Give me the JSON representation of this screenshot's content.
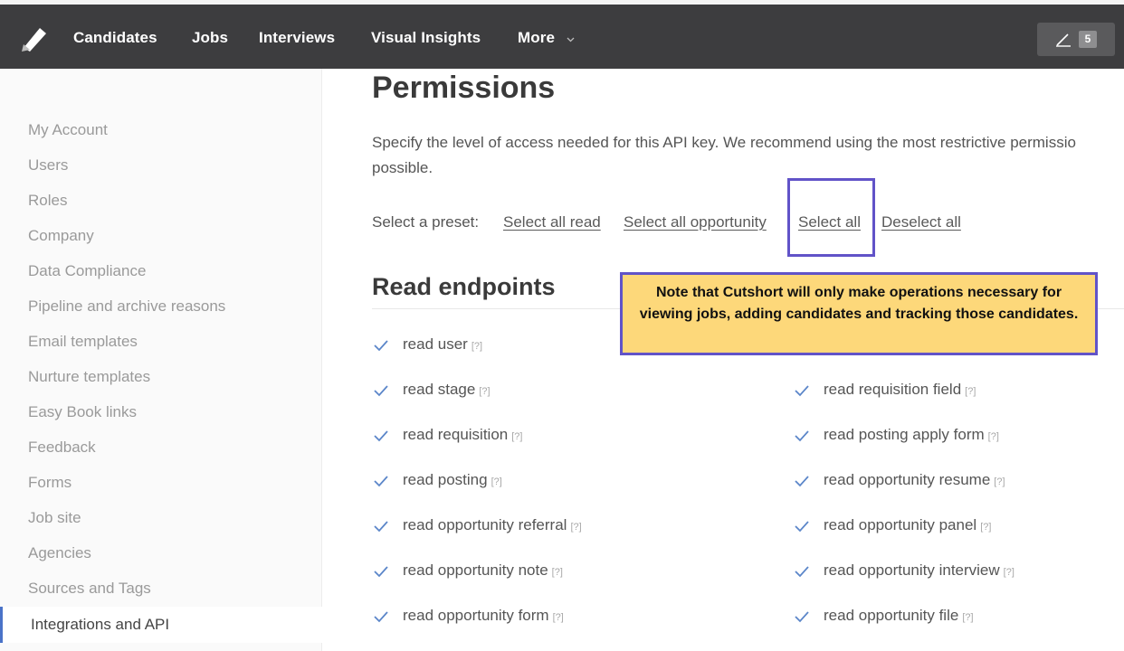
{
  "nav": {
    "items": [
      {
        "label": "Candidates"
      },
      {
        "label": "Jobs"
      },
      {
        "label": "Interviews"
      },
      {
        "label": "Visual Insights"
      },
      {
        "label": "More"
      }
    ],
    "badge_count": "5"
  },
  "sidebar": {
    "items": [
      {
        "label": "My Account"
      },
      {
        "label": "Users"
      },
      {
        "label": "Roles"
      },
      {
        "label": "Company"
      },
      {
        "label": "Data Compliance"
      },
      {
        "label": "Pipeline and archive reasons"
      },
      {
        "label": "Email templates"
      },
      {
        "label": "Nurture templates"
      },
      {
        "label": "Easy Book links"
      },
      {
        "label": "Feedback"
      },
      {
        "label": "Forms"
      },
      {
        "label": "Job site"
      },
      {
        "label": "Agencies"
      },
      {
        "label": "Sources and Tags"
      },
      {
        "label": "Integrations and API"
      }
    ],
    "active_index": 14
  },
  "main": {
    "title": "Permissions",
    "description_line1": "Specify the level of access needed for this API key. We recommend using the most restrictive permissio",
    "description_line2": "possible.",
    "preset_label": "Select a preset:",
    "presets": [
      {
        "label": "Select all read"
      },
      {
        "label": "Select all opportunity"
      },
      {
        "label": "Select all"
      },
      {
        "label": "Deselect all"
      }
    ],
    "section_title": "Read endpoints",
    "help_marker": "[?]",
    "permissions_left": [
      {
        "label": "read user",
        "checked": true
      },
      {
        "label": "read stage",
        "checked": true
      },
      {
        "label": "read requisition",
        "checked": true
      },
      {
        "label": "read posting",
        "checked": true
      },
      {
        "label": "read opportunity referral",
        "checked": true
      },
      {
        "label": "read opportunity note",
        "checked": true
      },
      {
        "label": "read opportunity form",
        "checked": true
      }
    ],
    "permissions_right": [
      {
        "label": "read requisition field",
        "checked": true
      },
      {
        "label": "read posting apply form",
        "checked": true
      },
      {
        "label": "read opportunity resume",
        "checked": true
      },
      {
        "label": "read opportunity panel",
        "checked": true
      },
      {
        "label": "read opportunity interview",
        "checked": true
      },
      {
        "label": "read opportunity file",
        "checked": true
      }
    ]
  },
  "tooltip": {
    "text": "Note that Cutshort will only make operations necessary for viewing jobs, adding candidates and tracking those candidates."
  },
  "colors": {
    "nav_bg": "#3d3d3f",
    "accent": "#4a73c8",
    "highlight_border": "#6153c8",
    "tooltip_bg": "#fdd87a",
    "check": "#5b86c9"
  }
}
